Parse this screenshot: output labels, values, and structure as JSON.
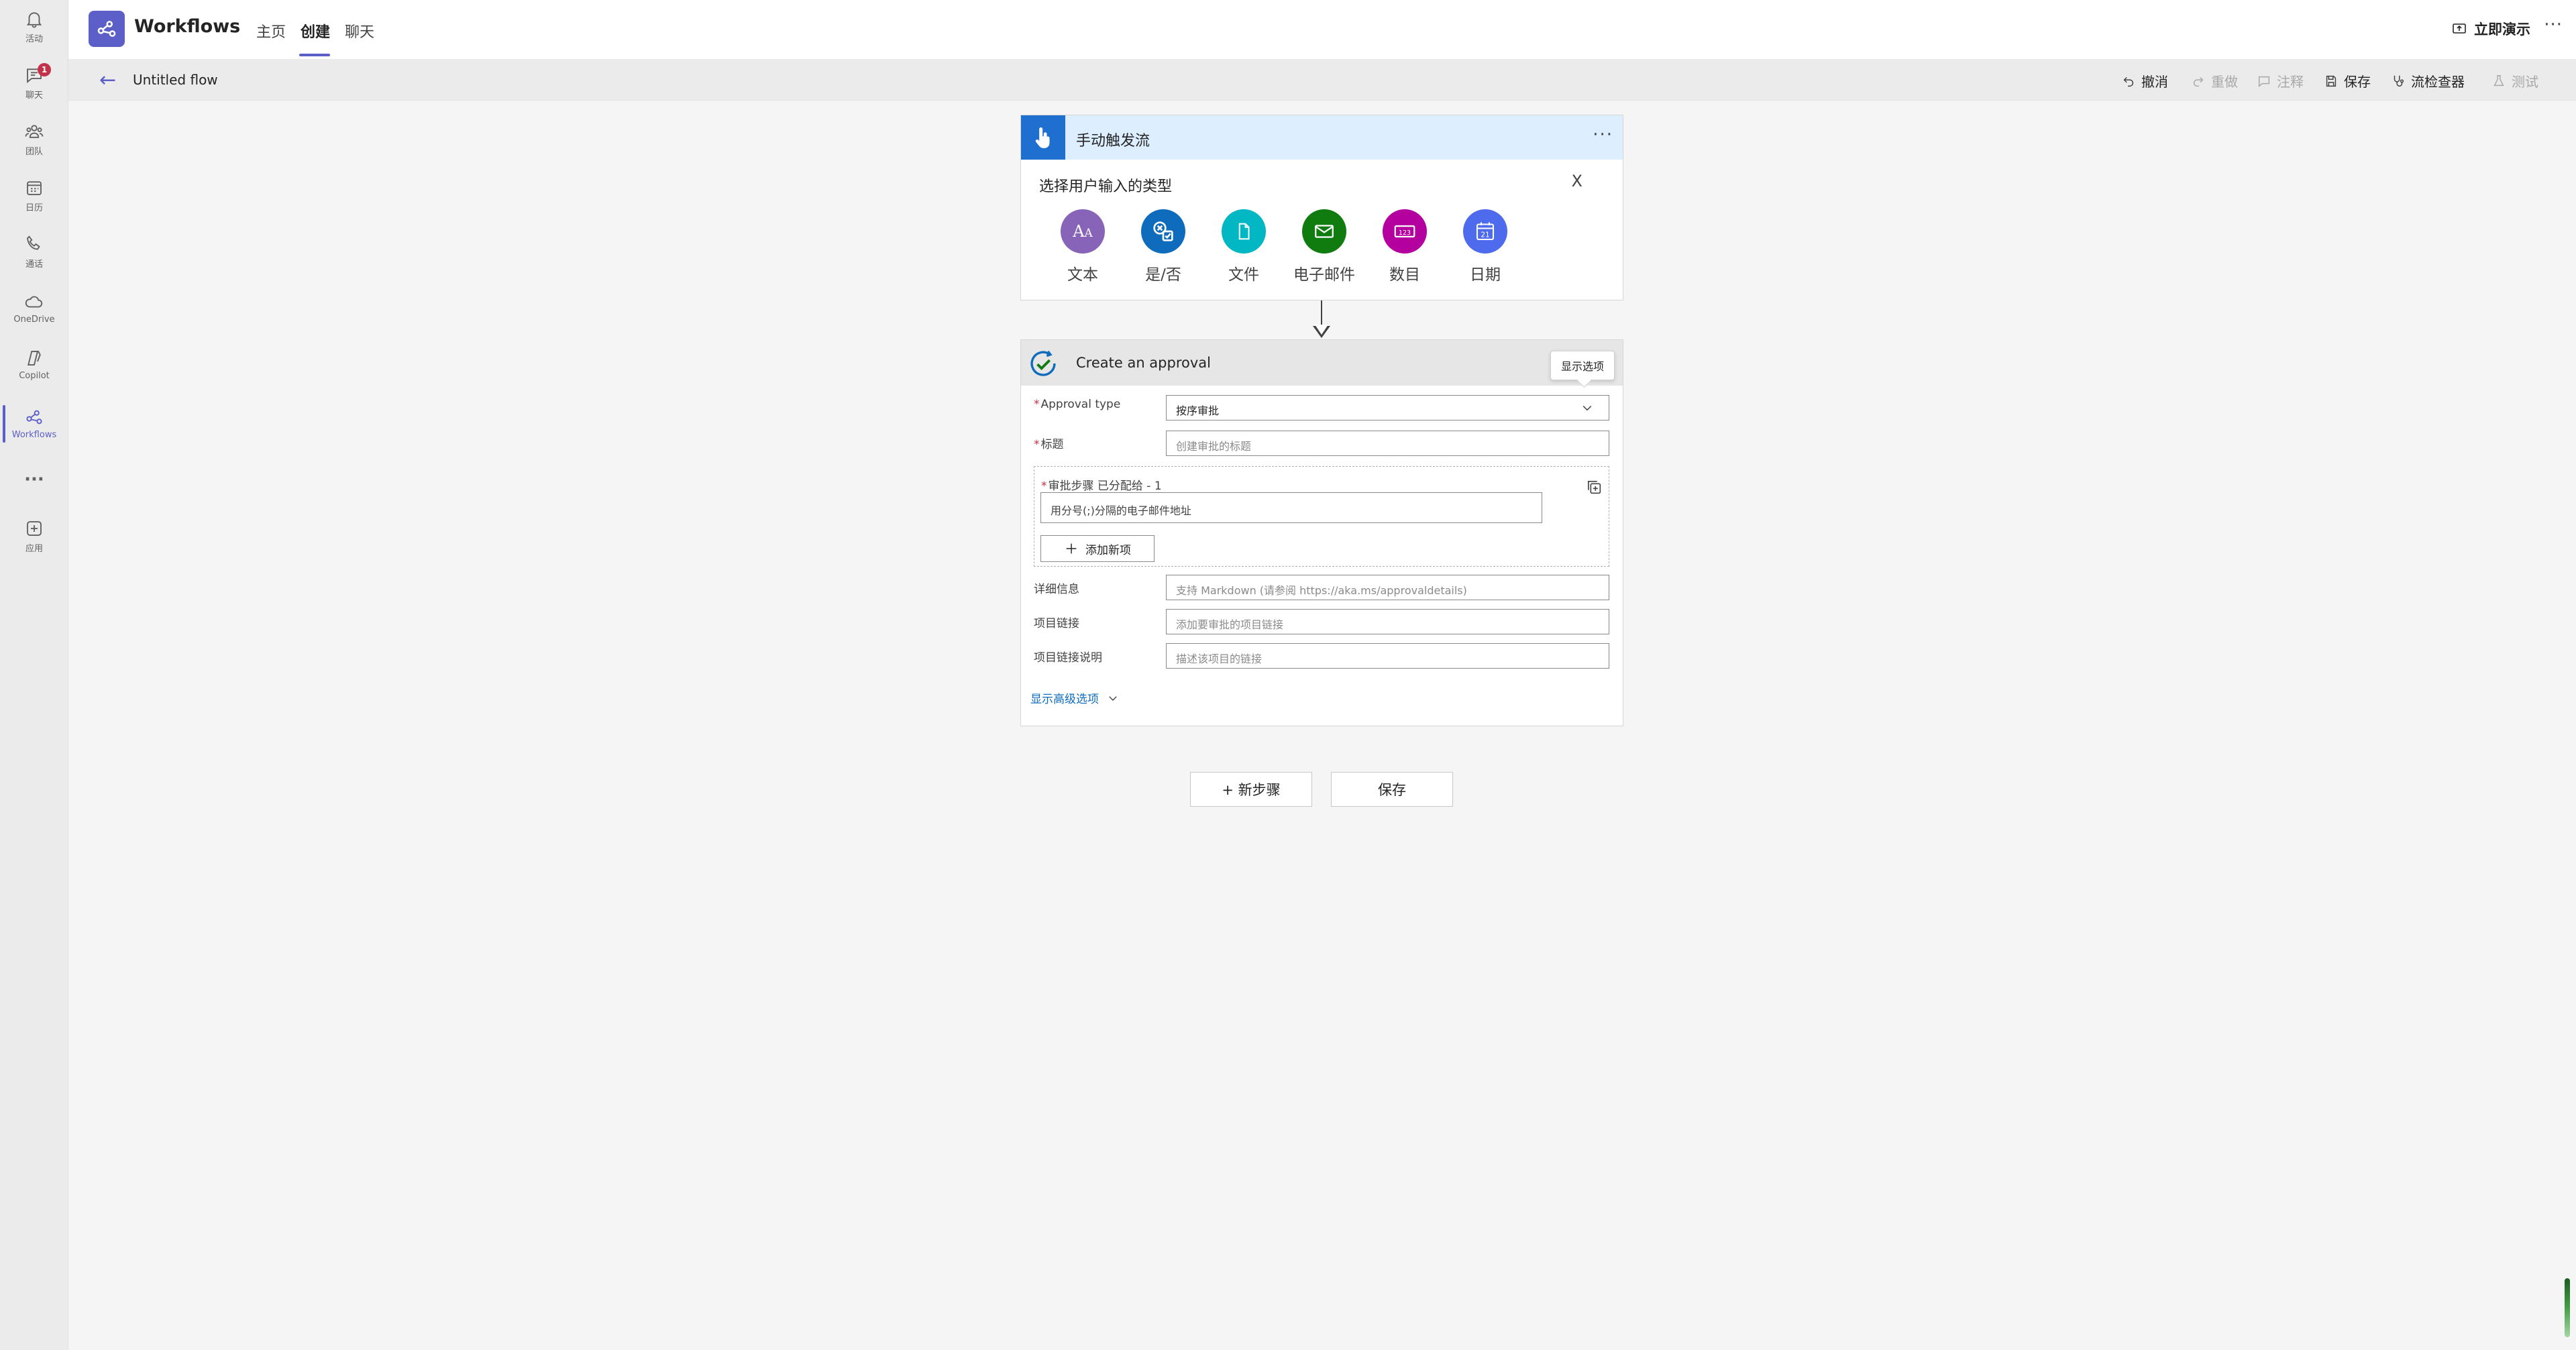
{
  "rail": {
    "items": [
      {
        "label": "活动",
        "icon": "bell-icon"
      },
      {
        "label": "聊天",
        "icon": "chat-icon",
        "badge": "1"
      },
      {
        "label": "团队",
        "icon": "teams-icon"
      },
      {
        "label": "日历",
        "icon": "calendar-icon"
      },
      {
        "label": "通话",
        "icon": "phone-icon"
      },
      {
        "label": "OneDrive",
        "icon": "cloud-icon"
      },
      {
        "label": "Copilot",
        "icon": "copilot-icon"
      },
      {
        "label": "Workflows",
        "icon": "workflows-icon",
        "active": true
      },
      {
        "label": "",
        "icon": "more-icon"
      },
      {
        "label": "应用",
        "icon": "add-apps-icon"
      }
    ],
    "more_glyph": "···"
  },
  "app": {
    "title": "Workflows",
    "tabs": [
      {
        "label": "主页"
      },
      {
        "label": "创建",
        "active": true
      },
      {
        "label": "聊天"
      }
    ],
    "present_label": "立即演示",
    "more_glyph": "···",
    "accent": "#5b5fc7"
  },
  "toolbar": {
    "flow_name": "Untitled flow",
    "undo": "撤消",
    "redo": "重做",
    "comment": "注释",
    "save": "保存",
    "checker": "流检查器",
    "test": "测试"
  },
  "trigger": {
    "title": "手动触发流",
    "more_glyph": "···",
    "input_type_title": "选择用户输入的类型",
    "close_label": "X",
    "types": [
      {
        "label": "文本",
        "color": "#8764b8",
        "icon": "text-icon"
      },
      {
        "label": "是/否",
        "color": "#0f6cbd",
        "icon": "yes-no-icon"
      },
      {
        "label": "文件",
        "color": "#00b7c3",
        "icon": "file-icon"
      },
      {
        "label": "电子邮件",
        "color": "#107c10",
        "icon": "email-icon"
      },
      {
        "label": "数目",
        "color": "#b4009e",
        "icon": "number-icon"
      },
      {
        "label": "日期",
        "color": "#4f6bed",
        "icon": "date-icon"
      }
    ]
  },
  "approval": {
    "title": "Create an approval",
    "tooltip": "显示选项",
    "approval_type_label": "Approval type",
    "approval_type_value": "按序审批",
    "title_label": "标题",
    "title_placeholder": "创建审批的标题",
    "steps_label": "审批步骤 已分配给 - 1",
    "steps_placeholder": "用分号(;)分隔的电子邮件地址",
    "add_item": "添加新项",
    "details_label": "详细信息",
    "details_placeholder": "支持 Markdown (请参阅 https://aka.ms/approvaldetails)",
    "item_link_label": "项目链接",
    "item_link_placeholder": "添加要审批的项目链接",
    "item_link_desc_label": "项目链接说明",
    "item_link_desc_placeholder": "描述该项目的链接",
    "advanced": "显示高级选项"
  },
  "actions": {
    "new_step": "+ 新步骤",
    "save": "保存"
  }
}
